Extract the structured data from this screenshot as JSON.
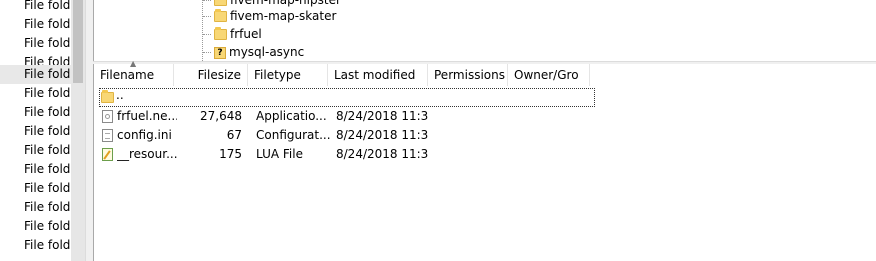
{
  "left_list": {
    "rows": [
      "File folde",
      "File folde",
      "File folde",
      "File folde",
      "File folde",
      "File folde",
      "File folde",
      "File folde",
      "File folde",
      "File folde",
      "File folde",
      "File folde",
      "File folde",
      "File folde"
    ]
  },
  "remote_tree": {
    "items": [
      {
        "label": "fivem-map-hipster",
        "icon": "folder-icon"
      },
      {
        "label": "fivem-map-skater",
        "icon": "folder-icon"
      },
      {
        "label": "frfuel",
        "icon": "folder-icon",
        "selected": true
      },
      {
        "label": "mysql-async",
        "icon": "unknown-folder-icon"
      }
    ]
  },
  "file_list": {
    "columns": [
      "Filename",
      "Filesize",
      "Filetype",
      "Last modified",
      "Permissions",
      "Owner/Gro"
    ],
    "parent_label": "..",
    "rows": [
      {
        "name": "frfuel.ne...",
        "size": "27,648",
        "type": "Applicatio...",
        "modified": "8/24/2018 11:3...",
        "icon": "application-file-icon"
      },
      {
        "name": "config.ini",
        "size": "67",
        "type": "Configurat...",
        "modified": "8/24/2018 11:3...",
        "icon": "config-file-icon"
      },
      {
        "name": "__resour...",
        "size": "175",
        "type": "LUA File",
        "modified": "8/24/2018 11:3...",
        "icon": "lua-file-icon"
      }
    ]
  }
}
